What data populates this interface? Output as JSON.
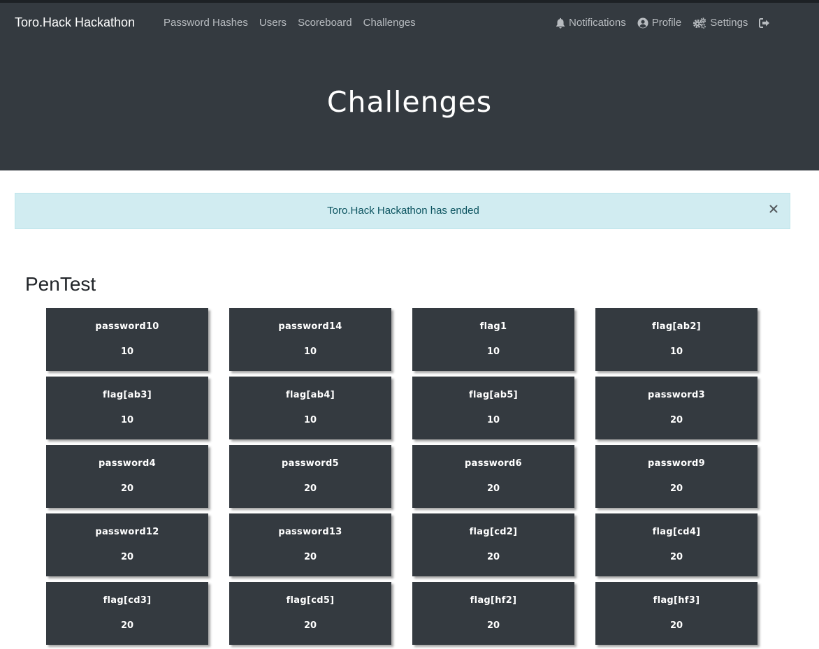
{
  "navbar": {
    "brand": "Toro.Hack Hackathon",
    "left_links": [
      "Password Hashes",
      "Users",
      "Scoreboard",
      "Challenges"
    ],
    "right_links": {
      "notifications": "Notifications",
      "profile": "Profile",
      "settings": "Settings"
    },
    "icons": [
      "bell-icon",
      "user-circle-icon",
      "gears-icon",
      "sign-out-icon"
    ]
  },
  "header": {
    "title": "Challenges"
  },
  "alert": {
    "message": "Toro.Hack Hackathon has ended",
    "close_symbol": "×"
  },
  "category": {
    "name": "PenTest",
    "challenges": [
      {
        "name": "password10",
        "value": "10"
      },
      {
        "name": "password14",
        "value": "10"
      },
      {
        "name": "flag1",
        "value": "10"
      },
      {
        "name": "flag[ab2]",
        "value": "10"
      },
      {
        "name": "flag[ab3]",
        "value": "10"
      },
      {
        "name": "flag[ab4]",
        "value": "10"
      },
      {
        "name": "flag[ab5]",
        "value": "10"
      },
      {
        "name": "password3",
        "value": "20"
      },
      {
        "name": "password4",
        "value": "20"
      },
      {
        "name": "password5",
        "value": "20"
      },
      {
        "name": "password6",
        "value": "20"
      },
      {
        "name": "password9",
        "value": "20"
      },
      {
        "name": "password12",
        "value": "20"
      },
      {
        "name": "password13",
        "value": "20"
      },
      {
        "name": "flag[cd2]",
        "value": "20"
      },
      {
        "name": "flag[cd4]",
        "value": "20"
      },
      {
        "name": "flag[cd3]",
        "value": "20"
      },
      {
        "name": "flag[cd5]",
        "value": "20"
      },
      {
        "name": "flag[hf2]",
        "value": "20"
      },
      {
        "name": "flag[hf3]",
        "value": "20"
      }
    ]
  },
  "colors": {
    "navbar_bg": "#343a40",
    "card_bg": "#343a40",
    "alert_bg": "#d1ecf1",
    "alert_text": "#0c5460"
  }
}
